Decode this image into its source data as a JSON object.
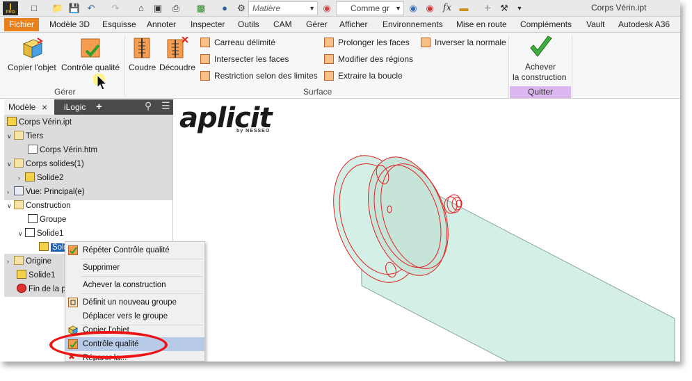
{
  "app": {
    "logo_text": "I",
    "logo_sub": "PRO",
    "file_title": "Corps Vérin.ipt"
  },
  "qat": {
    "material_placeholder": "Matière",
    "appearance_value": "Comme gr",
    "fx": "fx"
  },
  "menu_tabs": [
    "Fichier",
    "Modèle 3D",
    "Esquisse",
    "Annoter",
    "Inspecter",
    "Outils",
    "CAM",
    "Gérer",
    "Afficher",
    "Environnements",
    "Mise en route",
    "Compléments",
    "Vault",
    "Autodesk A36"
  ],
  "ribbon": {
    "gerer": {
      "name": "Gérer",
      "copy_object": "Copier l'objet",
      "quality_check": "Contrôle qualité"
    },
    "surface": {
      "name": "Surface",
      "stitch": "Coudre",
      "trim": "Découdre",
      "patch": "Carreau délimité",
      "intersect": "Intersecter les faces",
      "restrict": "Restriction selon des limites",
      "extend": "Prolonger les faces",
      "modify_regions": "Modifier des régions",
      "extract_loop": "Extraire la boucle",
      "reverse_normal": "Inverser la normale"
    },
    "quitter": {
      "name": "Quitter",
      "finish_line1": "Achever",
      "finish_line2": "la construction"
    }
  },
  "browser": {
    "tab_model": "Modèle",
    "tab_ilogic": "iLogic",
    "tree": [
      {
        "label": "Corps Vérin.ipt"
      },
      {
        "label": "Tiers"
      },
      {
        "label": "Corps Vérin.htm"
      },
      {
        "label": "Corps solides(1)"
      },
      {
        "label": "Solide2"
      },
      {
        "label": "Vue: Principal(e)"
      },
      {
        "label": "Construction"
      },
      {
        "label": "Groupe"
      },
      {
        "label": "Solide1"
      },
      {
        "label": "Solid"
      },
      {
        "label": "Origine"
      },
      {
        "label": "Solide1"
      },
      {
        "label": "Fin de la pièce"
      }
    ]
  },
  "context_menu": [
    {
      "label": "Répéter Contrôle qualité"
    },
    {
      "label": "Supprimer"
    },
    {
      "label": "Achever la construction"
    },
    {
      "label": "Définit un nouveau groupe"
    },
    {
      "label": "Déplacer vers le groupe"
    },
    {
      "label": "Copier l'objet"
    },
    {
      "label": "Contrôle qualité"
    },
    {
      "label": "Réparer la..."
    }
  ],
  "canvas": {
    "brand": "aplicit",
    "brand_sub": "by NESSEO"
  },
  "colors": {
    "accent": "#e8811c",
    "selection": "#1e5fb3",
    "quitter_band": "#dcb6ef",
    "highlight": "#ee1111",
    "cylinder_fill": "#d4efe6",
    "wire": "#e02020"
  }
}
